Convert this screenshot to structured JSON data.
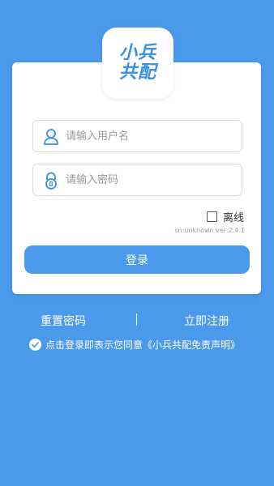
{
  "logo": {
    "line1": "小兵",
    "line2": "共配"
  },
  "login_form": {
    "username_placeholder": "请输入用户名",
    "password_placeholder": "请输入密码",
    "offline_label": "离线",
    "version_text": "sn:unknown ver:2.4.1",
    "login_button_label": "登录"
  },
  "links": {
    "reset_password": "重置密码",
    "separator": "|",
    "register_now": "立即注册"
  },
  "agreement": {
    "text": "点击登录即表示您同意《小兵共配免责声明》",
    "checked": true
  },
  "colors": {
    "background": "#4a99ea",
    "accent": "#4a99ea",
    "card": "#ffffff"
  },
  "icons": {
    "username": "user-icon",
    "password": "lock-icon",
    "agreement": "check-circle-icon"
  }
}
